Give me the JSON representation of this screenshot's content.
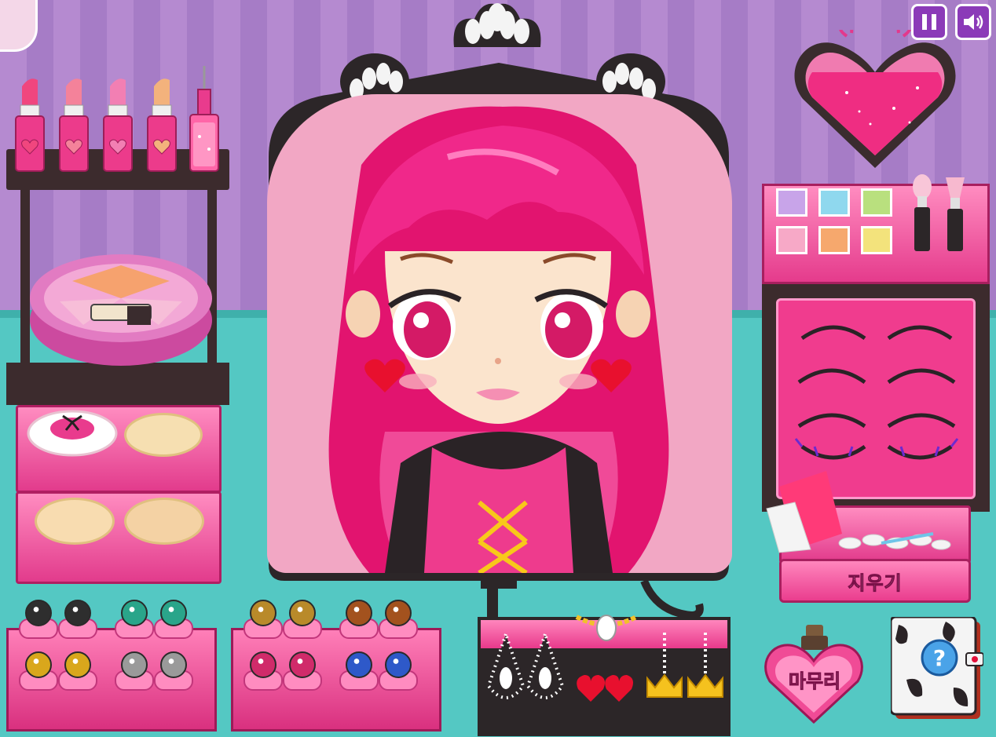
{
  "hud": {
    "pause_icon": "pause-icon",
    "sound_icon": "speaker-icon"
  },
  "buttons": {
    "eraser_label": "지우기",
    "finish_label": "마무리"
  },
  "colors": {
    "wall": "#b58ad0",
    "floor": "#54c8c3",
    "accent_pink": "#e93b8d",
    "dark_wood": "#3c2b2d"
  },
  "items": {
    "lipsticks": [
      "#f0467e",
      "#f4829a",
      "#f27fb3",
      "#f3b27c"
    ],
    "eyeshadows": [
      "#c8a4e9",
      "#8fd8ee",
      "#b9e07e",
      "#f7a9c7",
      "#f6a86d",
      "#f3e37c"
    ],
    "lenses_left": [
      "#2e2e2e",
      "#2e2e2e",
      "#2aa58a",
      "#2aa58a",
      "#d9a71c",
      "#d9a71c",
      "#9a9a9a",
      "#9a9a9a"
    ],
    "lenses_mid": [
      "#b98a2a",
      "#b98a2a",
      "#a3521e",
      "#a3521e",
      "#d02b6a",
      "#d02b6a",
      "#2e59c9",
      "#2e59c9"
    ]
  }
}
